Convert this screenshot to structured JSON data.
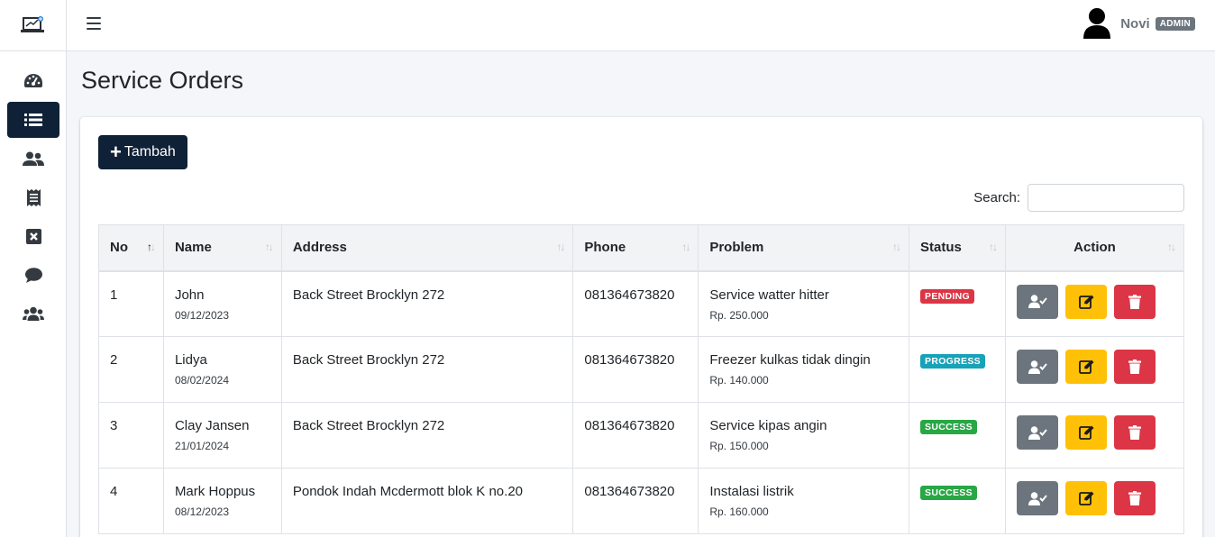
{
  "header": {
    "user_name": "Novi",
    "role": "ADMIN"
  },
  "sidebar": {
    "items": [
      {
        "icon": "dashboard-icon",
        "active": false
      },
      {
        "icon": "list-icon",
        "active": true
      },
      {
        "icon": "users-icon",
        "active": false
      },
      {
        "icon": "receipt-icon",
        "active": false
      },
      {
        "icon": "close-box-icon",
        "active": false
      },
      {
        "icon": "comment-icon",
        "active": false
      },
      {
        "icon": "group-icon",
        "active": false
      }
    ]
  },
  "page": {
    "title": "Service Orders"
  },
  "toolbar": {
    "add_label": "Tambah",
    "search_label": "Search:",
    "search_value": ""
  },
  "table": {
    "headers": [
      "No",
      "Name",
      "Address",
      "Phone",
      "Problem",
      "Status",
      "Action"
    ],
    "rows": [
      {
        "no": "1",
        "name": "John",
        "date": "09/12/2023",
        "address": "Back Street Brocklyn 272",
        "phone": "081364673820",
        "problem": "Service watter hitter",
        "price": "Rp. 250.000",
        "status": "PENDING",
        "status_class": "pending"
      },
      {
        "no": "2",
        "name": "Lidya",
        "date": "08/02/2024",
        "address": "Back Street Brocklyn 272",
        "phone": "081364673820",
        "problem": "Freezer kulkas tidak dingin",
        "price": "Rp. 140.000",
        "status": "PROGRESS",
        "status_class": "progress"
      },
      {
        "no": "3",
        "name": "Clay Jansen",
        "date": "21/01/2024",
        "address": "Back Street Brocklyn 272",
        "phone": "081364673820",
        "problem": "Service kipas angin",
        "price": "Rp. 150.000",
        "status": "SUCCESS",
        "status_class": "success"
      },
      {
        "no": "4",
        "name": "Mark Hoppus",
        "date": "08/12/2023",
        "address": "Pondok Indah Mcdermott blok K no.20",
        "phone": "081364673820",
        "problem": "Instalasi listrik",
        "price": "Rp. 160.000",
        "status": "SUCCESS",
        "status_class": "success"
      }
    ]
  },
  "colors": {
    "primary": "#0f2136",
    "pending": "#dc3545",
    "progress": "#17a2b8",
    "success": "#28a745",
    "assign": "#6c757d",
    "edit": "#ffc107",
    "delete": "#dc3545"
  }
}
